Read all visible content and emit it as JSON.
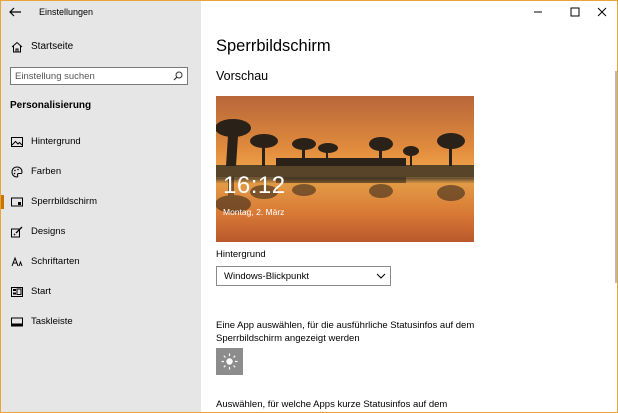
{
  "window": {
    "title": "Einstellungen",
    "accent_color": "#e8a33a",
    "controls": [
      "minimize-icon",
      "maximize-icon",
      "close-icon"
    ]
  },
  "sidebar": {
    "home_label": "Startseite",
    "search": {
      "placeholder": "Einstellung suchen",
      "value": ""
    },
    "section_title": "Personalisierung",
    "items": [
      {
        "label": "Hintergrund",
        "icon": "picture-icon",
        "active": false
      },
      {
        "label": "Farben",
        "icon": "palette-icon",
        "active": false
      },
      {
        "label": "Sperrbildschirm",
        "icon": "lockscreen-icon",
        "active": true
      },
      {
        "label": "Designs",
        "icon": "brush-icon",
        "active": false
      },
      {
        "label": "Schriftarten",
        "icon": "font-icon",
        "active": false
      },
      {
        "label": "Start",
        "icon": "start-icon",
        "active": false
      },
      {
        "label": "Taskleiste",
        "icon": "taskbar-icon",
        "active": false
      }
    ],
    "active_color": "#c77400"
  },
  "main": {
    "title": "Sperrbildschirm",
    "preview_heading": "Vorschau",
    "preview": {
      "time": "16:12",
      "date": "Montag, 2. März"
    },
    "background_label": "Hintergrund",
    "background_value": "Windows-Blickpunkt",
    "status_app_desc": "Eine App auswählen, für die ausführliche Statusinfos auf dem Sperrbildschirm angezeigt werden",
    "quick_status_desc": "Auswählen, für welche Apps kurze Statusinfos auf dem"
  }
}
